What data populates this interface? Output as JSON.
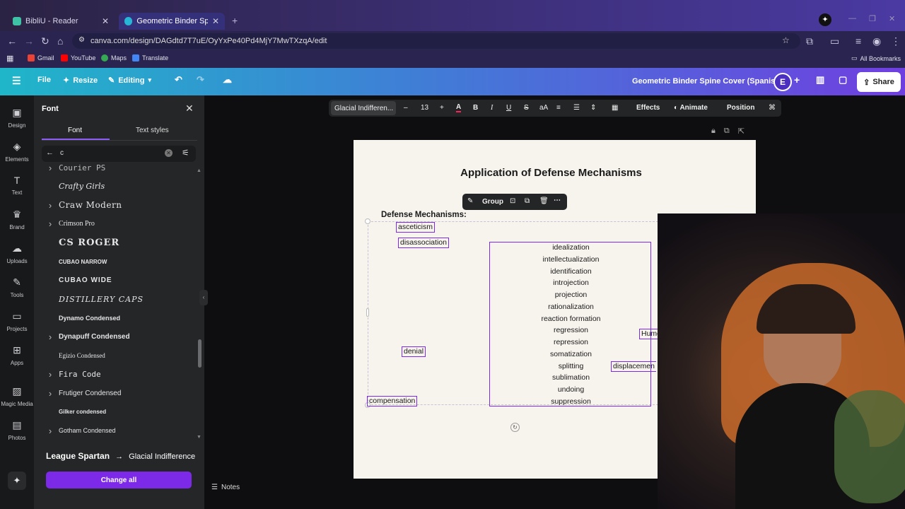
{
  "browser": {
    "tabs": [
      {
        "title": "BibliU - Reader"
      },
      {
        "title": "Geometric Binder Spine Cover"
      }
    ],
    "url": "canva.com/design/DAGdtd7T7uE/OyYxPe40Pd4MjY7MwTXzqA/edit",
    "bookmarks": [
      "Gmail",
      "YouTube",
      "Maps",
      "Translate"
    ],
    "all_bookmarks": "All Bookmarks"
  },
  "header": {
    "file": "File",
    "resize": "Resize",
    "editing": "Editing",
    "doc_title": "Geometric Binder Spine Cover (Spanish)",
    "avatar": "E",
    "share": "Share"
  },
  "rail": [
    {
      "label": "Design",
      "icon": "design-icon"
    },
    {
      "label": "Elements",
      "icon": "elements-icon"
    },
    {
      "label": "Text",
      "icon": "text-icon"
    },
    {
      "label": "Brand",
      "icon": "brand-icon"
    },
    {
      "label": "Uploads",
      "icon": "uploads-icon"
    },
    {
      "label": "Tools",
      "icon": "tools-icon"
    },
    {
      "label": "Projects",
      "icon": "projects-icon"
    },
    {
      "label": "Apps",
      "icon": "apps-icon"
    },
    {
      "label": "Magic Media",
      "icon": "magic-media-icon"
    },
    {
      "label": "Photos",
      "icon": "photos-icon"
    }
  ],
  "panel": {
    "title": "Font",
    "tabs": [
      "Font",
      "Text styles"
    ],
    "search_value": "c",
    "fonts": [
      {
        "name": "Courier PS",
        "expandable": true
      },
      {
        "name": "Crafty Girls",
        "expandable": false
      },
      {
        "name": "Craw Modern",
        "expandable": true
      },
      {
        "name": "Crimson Pro",
        "expandable": true
      },
      {
        "name": "CS ROGER",
        "expandable": false
      },
      {
        "name": "CUBAO NARROW",
        "expandable": false
      },
      {
        "name": "CUBAO WIDE",
        "expandable": false
      },
      {
        "name": "DISTILLERY CAPS",
        "expandable": false
      },
      {
        "name": "Dynamo Condensed",
        "expandable": false
      },
      {
        "name": "Dynapuff Condensed",
        "expandable": true
      },
      {
        "name": "Egizio Condensed",
        "expandable": false
      },
      {
        "name": "Fira Code",
        "expandable": true
      },
      {
        "name": "Frutiger Condensed",
        "expandable": true
      },
      {
        "name": "Gilker condensed",
        "expandable": false
      },
      {
        "name": "Gotham Condensed",
        "expandable": true
      }
    ],
    "replace_from": "League Spartan",
    "replace_to": "Glacial Indifference",
    "change_all": "Change all"
  },
  "toolbar": {
    "font": "Glacial Indifferen...",
    "size": "13",
    "effects": "Effects",
    "animate": "Animate",
    "position": "Position"
  },
  "group_toolbar": {
    "label": "Group"
  },
  "page": {
    "title": "Application of Defense Mechanisms",
    "heading": "Defense Mechanisms:",
    "boxes": {
      "asceticism": "asceticism",
      "disassociation": "disassociation",
      "denial": "denial",
      "compensation": "compensation",
      "humor": "Humo",
      "displacement": "displacemen"
    },
    "list": [
      "idealization",
      "intellectualization",
      "identification",
      "introjection",
      "projection",
      "rationalization",
      "reaction formation",
      "regression",
      "repression",
      "somatization",
      "splitting",
      "sublimation",
      "undoing",
      "suppression"
    ]
  },
  "notes": "Notes"
}
